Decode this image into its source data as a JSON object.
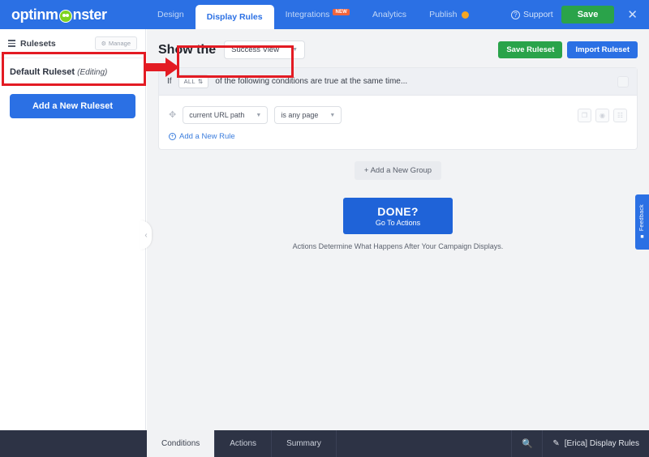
{
  "app": {
    "brand": "optinm",
    "brand_tail": "nster",
    "brand_icon": "monster-logo-icon"
  },
  "topnav": {
    "items": [
      {
        "label": "Design",
        "active": false,
        "badge": null,
        "dot": false
      },
      {
        "label": "Display Rules",
        "active": true,
        "badge": null,
        "dot": false
      },
      {
        "label": "Integrations",
        "active": false,
        "badge": "NEW",
        "dot": false
      },
      {
        "label": "Analytics",
        "active": false,
        "badge": null,
        "dot": false
      },
      {
        "label": "Publish",
        "active": false,
        "badge": null,
        "dot": true
      }
    ],
    "support_label": "Support",
    "support_icon": "question-circle-icon",
    "save_label": "Save",
    "close_icon": "close-icon"
  },
  "sidebar": {
    "title": "Rulesets",
    "title_icon": "list-icon",
    "manage_label": "Manage",
    "manage_icon": "gear-icon",
    "ruleset_name": "Default Ruleset",
    "ruleset_state": "(Editing)",
    "add_ruleset_label": "Add a New Ruleset",
    "collapse_icon": "chevron-left-icon"
  },
  "main": {
    "show_the_label": "Show the",
    "view_select_value": "Success View",
    "view_select_caret": "chevron-down-icon",
    "save_ruleset_label": "Save Ruleset",
    "import_ruleset_label": "Import Ruleset",
    "condition_prefix": "If",
    "condition_match": "ALL",
    "condition_match_icon": "sort-updown-icon",
    "condition_suffix": "of the following conditions are true at the same time...",
    "group_collapse_icon": "collapse-icon",
    "rule": {
      "drag_icon": "drag-handle-icon",
      "field_value": "current URL path",
      "operator_value": "is any page",
      "actions": [
        {
          "icon": "duplicate-icon",
          "glyph": "❐"
        },
        {
          "icon": "eye-icon",
          "glyph": "◉"
        },
        {
          "icon": "trash-icon",
          "glyph": "☷"
        }
      ]
    },
    "add_rule_label": "Add a New Rule",
    "add_rule_icon": "plus-circle-icon",
    "add_group_label": "+ Add a New Group",
    "done_title": "DONE?",
    "done_subtitle": "Go To Actions",
    "done_note": "Actions Determine What Happens After Your Campaign Displays."
  },
  "feedback": {
    "label": "Feedback",
    "icon": "feedback-icon"
  },
  "bottombar": {
    "tabs": [
      {
        "label": "Conditions",
        "active": true
      },
      {
        "label": "Actions",
        "active": false
      },
      {
        "label": "Summary",
        "active": false
      }
    ],
    "search_icon": "search-icon",
    "doc_icon": "pencil-icon",
    "doc_label": "[Erica] Display Rules"
  },
  "annotations": {
    "accent_color": "#e31b23",
    "boxes": [
      {
        "name": "default-ruleset-highlight"
      },
      {
        "name": "show-the-highlight"
      }
    ],
    "arrow": {
      "name": "red-arrow-right"
    }
  }
}
